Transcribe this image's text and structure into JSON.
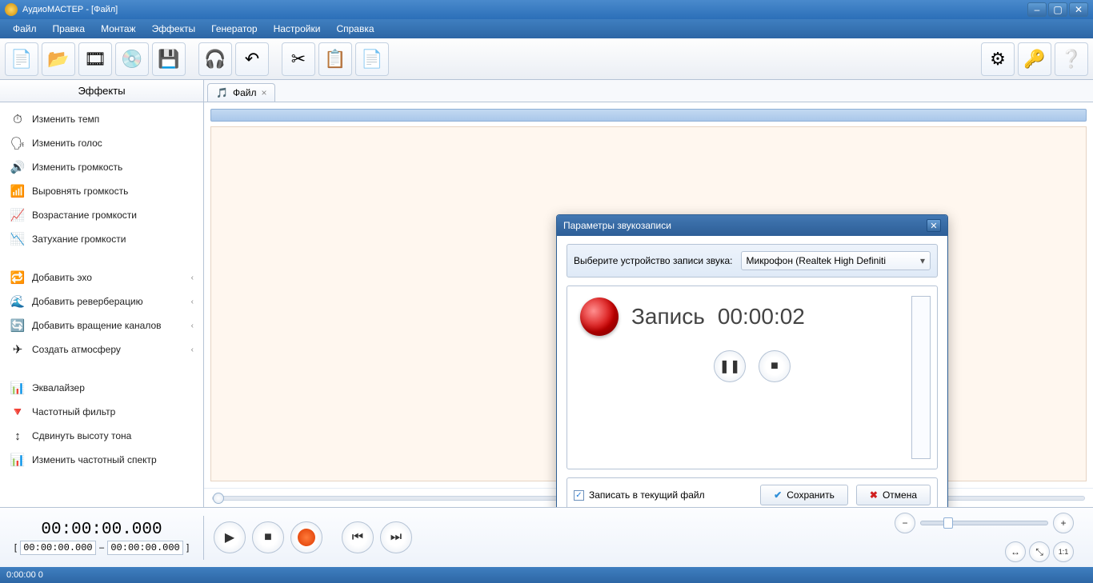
{
  "title": "АудиоМАСТЕР - [Файл]",
  "menus": [
    "Файл",
    "Правка",
    "Монтаж",
    "Эффекты",
    "Генератор",
    "Настройки",
    "Справка"
  ],
  "toolbar_icons": {
    "new": "📄",
    "open": "📂",
    "video": "🎞",
    "cd": "💿",
    "save": "💾",
    "paste_clip": "🎧",
    "undo": "↶",
    "cut": "✂",
    "copy": "📋",
    "paste": "📄",
    "settings": "⚙",
    "key": "🔑",
    "help": "❔"
  },
  "sidebar": {
    "header": "Эффекты",
    "groups": [
      [
        {
          "icon": "⏱",
          "label": "Изменить темп"
        },
        {
          "icon": "🗣",
          "label": "Изменить голос"
        },
        {
          "icon": "🔊",
          "label": "Изменить громкость"
        },
        {
          "icon": "📶",
          "label": "Выровнять громкость"
        },
        {
          "icon": "📈",
          "label": "Возрастание громкости"
        },
        {
          "icon": "📉",
          "label": "Затухание громкости"
        }
      ],
      [
        {
          "icon": "🔁",
          "label": "Добавить эхо",
          "arrow": true
        },
        {
          "icon": "🌊",
          "label": "Добавить реверберацию",
          "arrow": true
        },
        {
          "icon": "🔄",
          "label": "Добавить вращение каналов",
          "arrow": true
        },
        {
          "icon": "✈",
          "label": "Создать атмосферу",
          "arrow": true
        }
      ],
      [
        {
          "icon": "📊",
          "label": "Эквалайзер"
        },
        {
          "icon": "🔻",
          "label": "Частотный фильтр"
        },
        {
          "icon": "↕",
          "label": "Сдвинуть высоту тона"
        },
        {
          "icon": "📊",
          "label": "Изменить частотный спектр"
        }
      ]
    ]
  },
  "tab": {
    "icon": "🎵",
    "label": "Файл"
  },
  "dialog": {
    "title": "Параметры звукозаписи",
    "device_label": "Выберите устройство записи звука:",
    "device_value": "Микрофон (Realtek High Definiti",
    "rec_label": "Запись",
    "rec_time": "00:00:02",
    "checkbox": "Записать в текущий файл",
    "save": "Сохранить",
    "cancel": "Отмена"
  },
  "time": {
    "big": "00:00:00.000",
    "from": "00:00:00.000",
    "to": "00:00:00.000"
  },
  "status": "0:00:00 0"
}
